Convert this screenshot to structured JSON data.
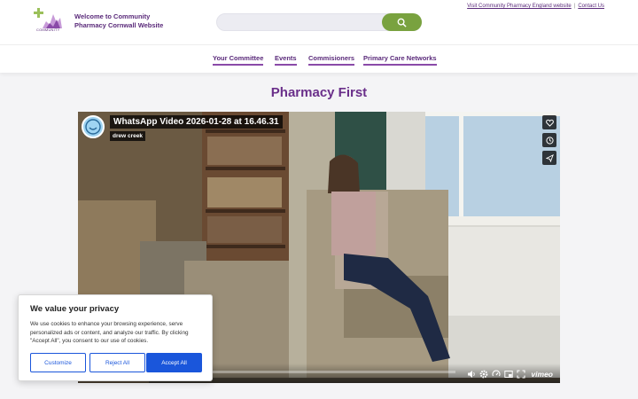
{
  "header": {
    "logo_text": "COMMUNITY",
    "welcome_line1": "Welcome to Community",
    "welcome_line2": "Pharmacy Cornwall Website",
    "search_placeholder": "",
    "links": [
      "Visit Community Pharmacy England website",
      "Contact Us"
    ],
    "link_separator": "|"
  },
  "nav": {
    "items": [
      "Your Committee",
      "Events",
      "Commisioners",
      "Primary Care Networks"
    ]
  },
  "page": {
    "title": "Pharmacy First"
  },
  "video": {
    "title": "WhatsApp Video 2026-01-28 at 16.46.31",
    "author": "drew creek",
    "brand": "vimeo",
    "side_icons": [
      "heart-icon",
      "clock-icon",
      "send-icon"
    ],
    "control_icons": [
      "volume-icon",
      "settings-icon",
      "speed-icon",
      "pip-icon",
      "fullscreen-icon"
    ]
  },
  "cookie": {
    "heading": "We value your privacy",
    "body": "We use cookies to enhance your browsing experience, serve personalized ads or content, and analyze our traffic. By clicking \"Accept All\", you consent to our use of cookies.",
    "customize": "Customize",
    "reject": "Reject All",
    "accept": "Accept All"
  },
  "colors": {
    "brand_purple": "#5a2a7a",
    "search_green": "#79a23f",
    "cookie_blue": "#1a56db"
  }
}
